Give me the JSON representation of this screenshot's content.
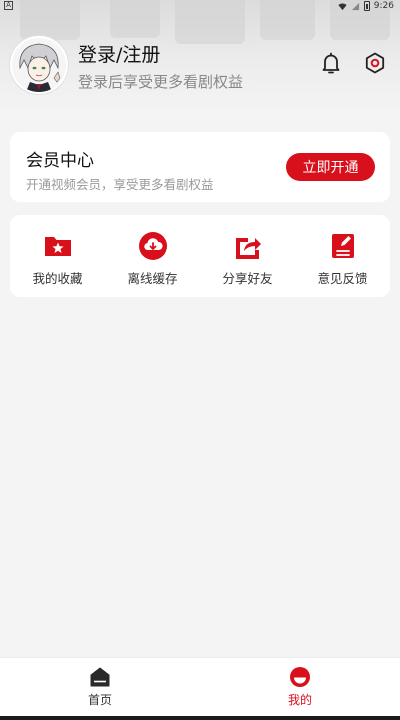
{
  "status_bar": {
    "left_icon": "A",
    "time": "9:26"
  },
  "profile": {
    "title": "登录/注册",
    "subtitle": "登录后享受更多看剧权益",
    "avatar_icon": "anime-character-avatar"
  },
  "header_icons": {
    "bell": "bell-icon",
    "settings": "gear-icon"
  },
  "vip": {
    "title": "会员中心",
    "subtitle": "开通视频会员，享受更多看剧权益",
    "button_label": "立即开通"
  },
  "functions": [
    {
      "label": "我的收藏",
      "icon": "folder-star-icon"
    },
    {
      "label": "离线缓存",
      "icon": "cloud-download-icon"
    },
    {
      "label": "分享好友",
      "icon": "share-icon"
    },
    {
      "label": "意见反馈",
      "icon": "feedback-edit-icon"
    }
  ],
  "tabs": [
    {
      "label": "首页",
      "icon": "home-icon",
      "active": false
    },
    {
      "label": "我的",
      "icon": "profile-icon",
      "active": true
    }
  ],
  "colors": {
    "accent": "#d8101c",
    "background": "#f4f4f5",
    "card": "#ffffff",
    "text_primary": "#111111",
    "text_secondary": "#888888"
  }
}
